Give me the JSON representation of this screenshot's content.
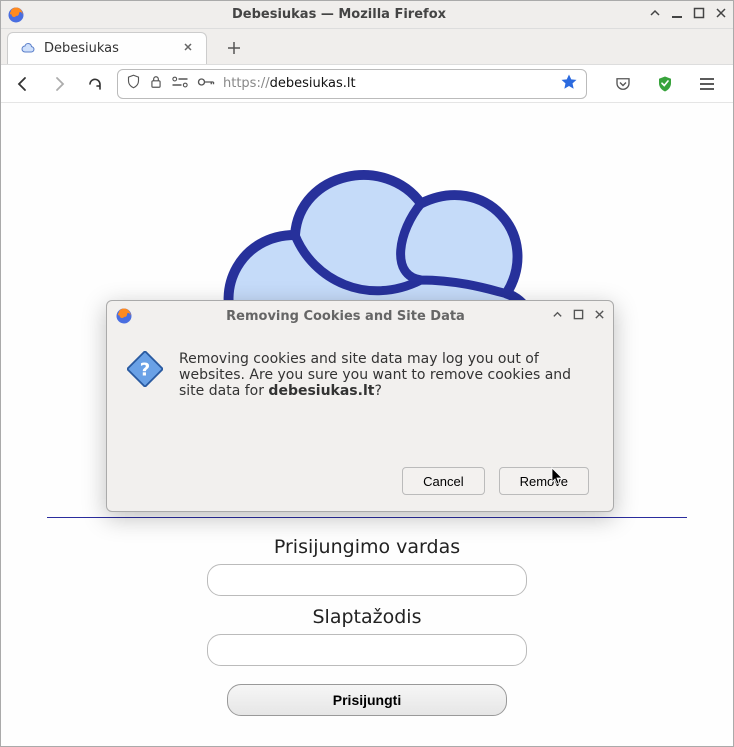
{
  "window": {
    "title": "Debesiukas — Mozilla Firefox"
  },
  "tab": {
    "title": "Debesiukas"
  },
  "url": {
    "protocol": "https://",
    "domain": "debesiukas.lt"
  },
  "page": {
    "username_label": "Prisijungimo vardas",
    "password_label": "Slaptažodis",
    "submit_label": "Prisijungti"
  },
  "dialog": {
    "title": "Removing Cookies and Site Data",
    "body_pre": "Removing cookies and site data may log you out of websites. Are you sure you want to remove cookies and site data for ",
    "body_domain": "debesiukas.lt",
    "body_post": "?",
    "cancel": "Cancel",
    "remove": "Remove"
  }
}
